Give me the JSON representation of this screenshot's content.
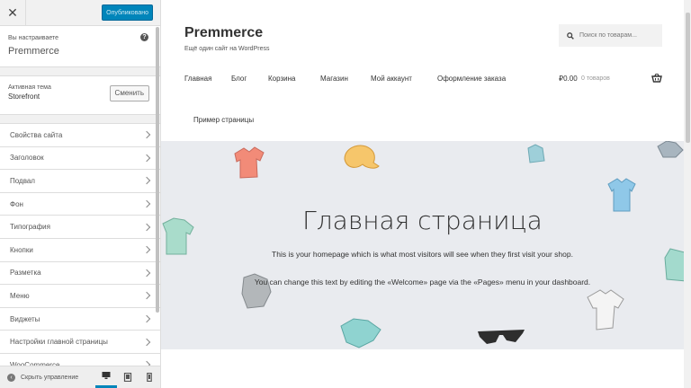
{
  "customizer": {
    "close_label": "✕",
    "publish_label": "Опубликовано",
    "customizing_label": "Вы настраиваете",
    "site_name": "Premmerce",
    "help_icon": "?",
    "active_theme_label": "Активная тема",
    "active_theme_name": "Storefront",
    "change_label": "Сменить",
    "sections": [
      {
        "label": "Свойства сайта"
      },
      {
        "label": "Заголовок"
      },
      {
        "label": "Подвал"
      },
      {
        "label": "Фон"
      },
      {
        "label": "Типография"
      },
      {
        "label": "Кнопки"
      },
      {
        "label": "Разметка"
      },
      {
        "label": "Меню"
      },
      {
        "label": "Виджеты"
      },
      {
        "label": "Настройки главной страницы"
      },
      {
        "label": "WooCommerce"
      }
    ],
    "collapse_label": "Скрыть управление",
    "devices": [
      "desktop-icon",
      "tablet-icon",
      "mobile-icon"
    ],
    "accent_color": "#0085ba"
  },
  "store": {
    "title": "Premmerce",
    "tagline": "Ещё один сайт на WordPress",
    "search_placeholder": "Поиск по товарам...",
    "nav": [
      "Главная",
      "Блог",
      "Корзина",
      "Магазин",
      "Мой аккаунт",
      "Оформление заказа",
      "Пример страницы"
    ],
    "cart_amount": "₽0.00",
    "cart_count": "0 товаров",
    "hero": {
      "title": "Главная страница",
      "line1": "This is your homepage which is what most visitors will see when they first visit your shop.",
      "line2": "You can change this text by editing the «Welcome» page via the «Pages» menu in your dashboard."
    }
  }
}
